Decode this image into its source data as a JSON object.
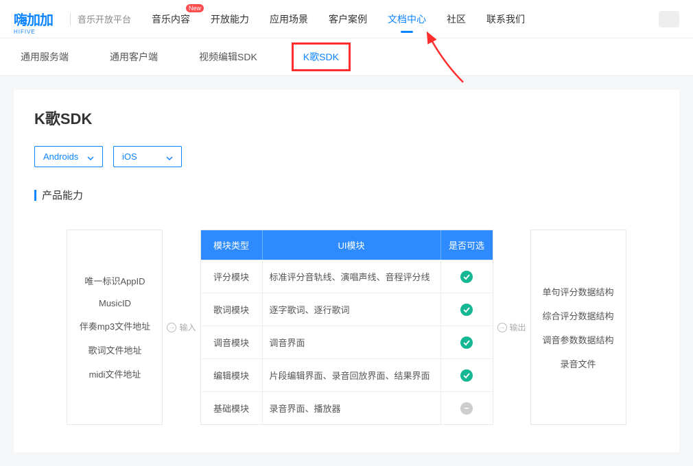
{
  "header": {
    "logo_main": "嗨加加",
    "logo_sub": "HIFIVE",
    "platform_name": "音乐开放平台",
    "nav": [
      {
        "label": "音乐内容",
        "badge": "New"
      },
      {
        "label": "开放能力"
      },
      {
        "label": "应用场景"
      },
      {
        "label": "客户案例"
      },
      {
        "label": "文档中心",
        "active": true
      },
      {
        "label": "社区"
      },
      {
        "label": "联系我们"
      }
    ]
  },
  "subnav": {
    "items": [
      {
        "label": "通用服务端"
      },
      {
        "label": "通用客户端"
      },
      {
        "label": "视频编辑SDK"
      },
      {
        "label": "K歌SDK",
        "highlighted": true
      }
    ]
  },
  "page": {
    "title": "K歌SDK",
    "platforms": [
      {
        "label": "Androids"
      },
      {
        "label": "iOS"
      }
    ],
    "section_title": "产品能力"
  },
  "flow": {
    "input_label": "输入",
    "output_label": "输出",
    "inputs": [
      "唯一标识AppID",
      "MusicID",
      "伴奏mp3文件地址",
      "歌词文件地址",
      "midi文件地址"
    ],
    "outputs": [
      "单句评分数据结构",
      "综合评分数据结构",
      "调音参数数据结构",
      "录音文件"
    ],
    "table": {
      "headers": [
        "模块类型",
        "UI模块",
        "是否可选"
      ],
      "rows": [
        {
          "type": "评分模块",
          "ui": "标准评分音轨线、演唱声线、音程评分线",
          "opt": "check"
        },
        {
          "type": "歌词模块",
          "ui": "逐字歌词、逐行歌词",
          "opt": "check"
        },
        {
          "type": "调音模块",
          "ui": "调音界面",
          "opt": "check"
        },
        {
          "type": "编辑模块",
          "ui": "片段编辑界面、录音回放界面、结果界面",
          "opt": "check"
        },
        {
          "type": "基础模块",
          "ui": "录音界面、播放器",
          "opt": "dash"
        }
      ]
    }
  }
}
